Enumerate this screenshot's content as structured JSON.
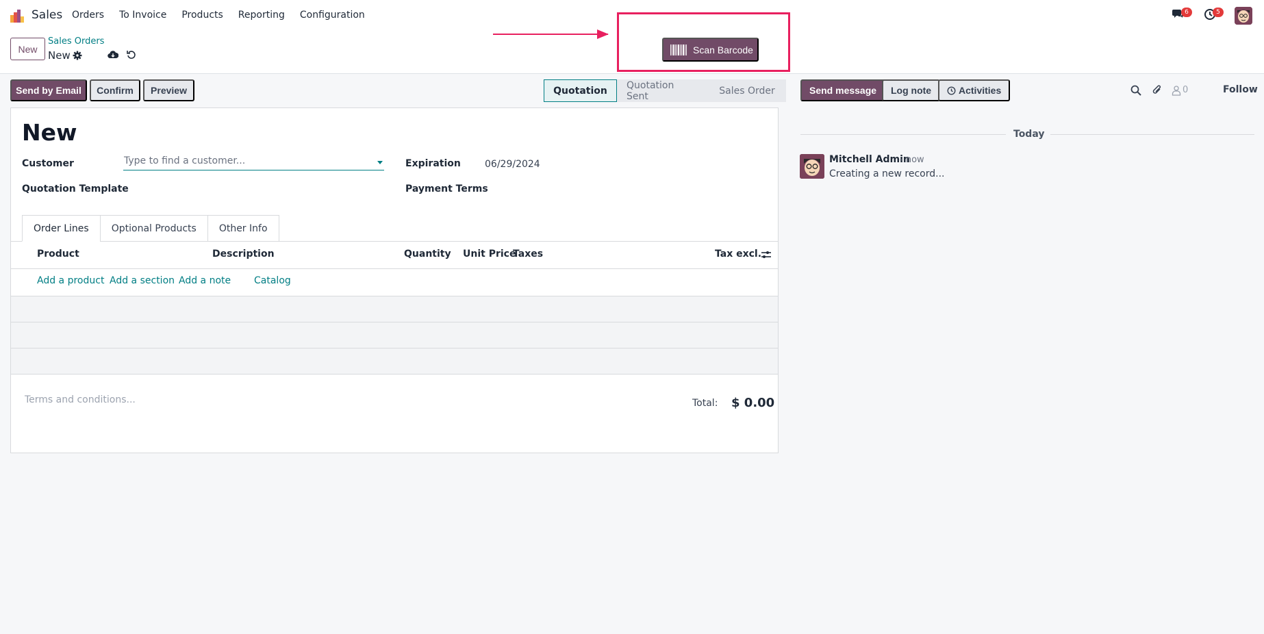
{
  "topbar": {
    "app_name": "Sales",
    "menu": [
      "Orders",
      "To Invoice",
      "Products",
      "Reporting",
      "Configuration"
    ],
    "chat_count": "6",
    "activity_count": "5"
  },
  "control_panel": {
    "new_label": "New",
    "breadcrumb_parent": "Sales Orders",
    "breadcrumb_current": "New",
    "scan_label": "Scan Barcode"
  },
  "actions": {
    "send_email": "Send by Email",
    "confirm": "Confirm",
    "preview": "Preview"
  },
  "status": [
    "Quotation",
    "Quotation Sent",
    "Sales Order"
  ],
  "form": {
    "title": "New",
    "customer_label": "Customer",
    "customer_placeholder": "Type to find a customer...",
    "expiration_label": "Expiration",
    "expiration_value": "06/29/2024",
    "template_label": "Quotation Template",
    "payment_terms_label": "Payment Terms",
    "tabs": [
      "Order Lines",
      "Optional Products",
      "Other Info"
    ],
    "columns": {
      "product": "Product",
      "description": "Description",
      "quantity": "Quantity",
      "unit_price": "Unit Price",
      "taxes": "Taxes",
      "tax_excl": "Tax excl."
    },
    "links": {
      "add_product": "Add a product",
      "add_section": "Add a section",
      "add_note": "Add a note",
      "catalog": "Catalog"
    },
    "terms_placeholder": "Terms and conditions...",
    "total_label": "Total:",
    "total_value": "$ 0.00"
  },
  "chatter": {
    "send_message": "Send message",
    "log_note": "Log note",
    "activities": "Activities",
    "follower_count": "0",
    "follow": "Follow",
    "today": "Today",
    "message": {
      "author": "Mitchell Admin",
      "time": "- now",
      "body": "Creating a new record..."
    }
  },
  "colors": {
    "primary": "#714b67",
    "link": "#017e84",
    "highlight": "#e8205f",
    "badge": "#e33a3a"
  }
}
